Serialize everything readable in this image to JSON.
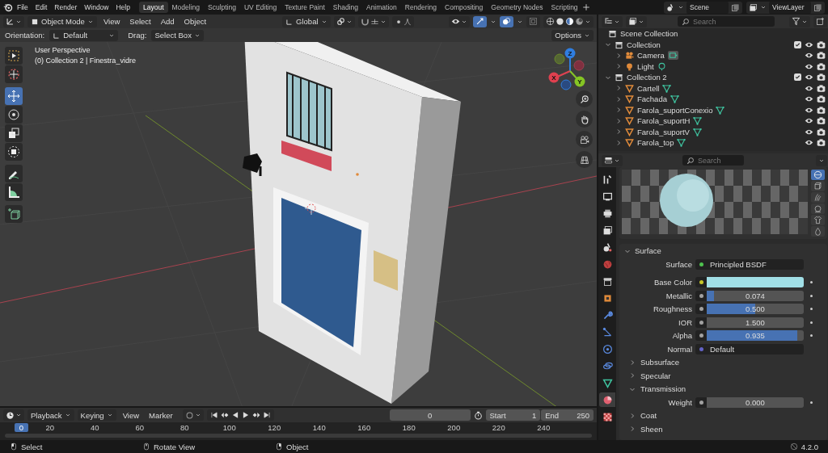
{
  "menu": [
    "File",
    "Edit",
    "Render",
    "Window",
    "Help"
  ],
  "workspaces": [
    {
      "label": "Layout",
      "selected": true
    },
    {
      "label": "Modeling",
      "selected": false
    },
    {
      "label": "Sculpting",
      "selected": false
    },
    {
      "label": "UV Editing",
      "selected": false
    },
    {
      "label": "Texture Paint",
      "selected": false
    },
    {
      "label": "Shading",
      "selected": false
    },
    {
      "label": "Animation",
      "selected": false
    },
    {
      "label": "Rendering",
      "selected": false
    },
    {
      "label": "Compositing",
      "selected": false
    },
    {
      "label": "Geometry Nodes",
      "selected": false
    },
    {
      "label": "Scripting",
      "selected": false
    }
  ],
  "scene": {
    "name": "Scene",
    "view_layer": "ViewLayer"
  },
  "viewport_header": {
    "mode": "Object Mode",
    "menus": [
      "View",
      "Select",
      "Add",
      "Object"
    ],
    "orientation": "Global"
  },
  "tool_settings": {
    "orientation_label": "Orientation:",
    "orientation": "Default",
    "drag_label": "Drag:",
    "drag": "Select Box",
    "options": "Options"
  },
  "viewport": {
    "view_name": "User Perspective",
    "context": "(0) Collection 2 | Finestra_vidre",
    "axes": [
      "X",
      "Y",
      "Z"
    ],
    "tools": [
      {
        "kind": "select",
        "selected": false
      },
      {
        "kind": "cursor",
        "selected": false
      },
      {
        "kind": "move",
        "selected": true
      },
      {
        "kind": "rotate",
        "selected": false
      },
      {
        "kind": "scale",
        "selected": false
      },
      {
        "kind": "transform",
        "selected": false
      },
      {
        "kind": "annotate",
        "selected": false
      },
      {
        "kind": "measure",
        "selected": false
      },
      {
        "kind": "add_cube",
        "selected": false
      }
    ]
  },
  "outliner": {
    "search_placeholder": "Search",
    "root": "Scene Collection",
    "items": [
      {
        "name": "Collection",
        "kind": "collection",
        "expanded": true,
        "included": true,
        "children": [
          {
            "name": "Camera",
            "kind": "camera",
            "expanded": false
          },
          {
            "name": "Light",
            "kind": "light",
            "expanded": false
          }
        ]
      },
      {
        "name": "Collection 2",
        "kind": "collection",
        "expanded": true,
        "included": true,
        "children": [
          {
            "name": "Cartell",
            "kind": "mesh",
            "expanded": false
          },
          {
            "name": "Fachada",
            "kind": "mesh",
            "expanded": false
          },
          {
            "name": "Farola_suportConexio",
            "kind": "mesh",
            "expanded": false
          },
          {
            "name": "Farola_suportH",
            "kind": "mesh",
            "expanded": false
          },
          {
            "name": "Farola_suportV",
            "kind": "mesh",
            "expanded": false
          },
          {
            "name": "Farola_top",
            "kind": "mesh",
            "expanded": false
          }
        ]
      }
    ]
  },
  "properties": {
    "search_placeholder": "Search",
    "tabs": [
      {
        "kind": "tool",
        "selected": false
      },
      {
        "kind": "render",
        "selected": false
      },
      {
        "kind": "output",
        "selected": false
      },
      {
        "kind": "view_layer",
        "selected": false
      },
      {
        "kind": "scene",
        "selected": false
      },
      {
        "kind": "world",
        "selected": false
      },
      {
        "kind": "collection",
        "selected": false
      },
      {
        "kind": "object",
        "selected": false
      },
      {
        "kind": "modifiers",
        "selected": false
      },
      {
        "kind": "particles",
        "selected": false
      },
      {
        "kind": "physics",
        "selected": false
      },
      {
        "kind": "constraints",
        "selected": false
      },
      {
        "kind": "data",
        "selected": false
      },
      {
        "kind": "material",
        "selected": true
      },
      {
        "kind": "texture",
        "selected": false
      }
    ],
    "preview_shapes": [
      {
        "kind": "sphere",
        "selected": true
      },
      {
        "kind": "cube",
        "selected": false
      },
      {
        "kind": "hair",
        "selected": false
      },
      {
        "kind": "monkey",
        "selected": false
      },
      {
        "kind": "cloth",
        "selected": false
      },
      {
        "kind": "fluid",
        "selected": false
      }
    ],
    "surface_panel": {
      "title": "Surface",
      "expanded": true,
      "rows": [
        {
          "kind": "link",
          "label": "Surface",
          "value": "Principled BSDF",
          "color": "#4fc24f"
        },
        {
          "kind": "color",
          "label": "Base Color",
          "swatch": {
            "color": "#a1dfe6"
          },
          "color": "#c7c729"
        },
        {
          "kind": "slider",
          "label": "Metallic",
          "value": "0.074",
          "level": 0.074,
          "color": "#a1a1a1"
        },
        {
          "kind": "slider",
          "label": "Roughness",
          "value": "0.500",
          "level": 0.5,
          "color": "#a1a1a1"
        },
        {
          "kind": "number",
          "label": "IOR",
          "value": "1.500",
          "color": "#a1a1a1"
        },
        {
          "kind": "slider",
          "label": "Alpha",
          "value": "0.935",
          "level": 0.935,
          "color": "#a1a1a1"
        },
        {
          "kind": "link",
          "label": "Normal",
          "value": "Default",
          "color": "#6363c7"
        }
      ]
    },
    "subpanels": [
      {
        "title": "Subsurface",
        "expanded": false
      },
      {
        "title": "Specular",
        "expanded": false
      },
      {
        "title": "Transmission",
        "expanded": true,
        "rows": [
          {
            "kind": "number",
            "label": "Weight",
            "value": "0.000",
            "color": "#a1a1a1"
          }
        ]
      },
      {
        "title": "Coat",
        "expanded": false
      },
      {
        "title": "Sheen",
        "expanded": false
      }
    ]
  },
  "timeline": {
    "menus": [
      "Playback",
      "Keying",
      "View",
      "Marker"
    ],
    "current_frame": "0",
    "start_label": "Start",
    "start": "1",
    "end_label": "End",
    "end": "250",
    "playhead": "0",
    "ticks": [
      "20",
      "40",
      "60",
      "80",
      "100",
      "120",
      "140",
      "160",
      "180",
      "200",
      "220",
      "240"
    ]
  },
  "status_bar": {
    "hints": [
      {
        "kind": "left",
        "label": "Select"
      },
      {
        "kind": "middle",
        "label": "Rotate View"
      },
      {
        "kind": "right",
        "label": "Object"
      }
    ],
    "version": "4.2.0"
  }
}
